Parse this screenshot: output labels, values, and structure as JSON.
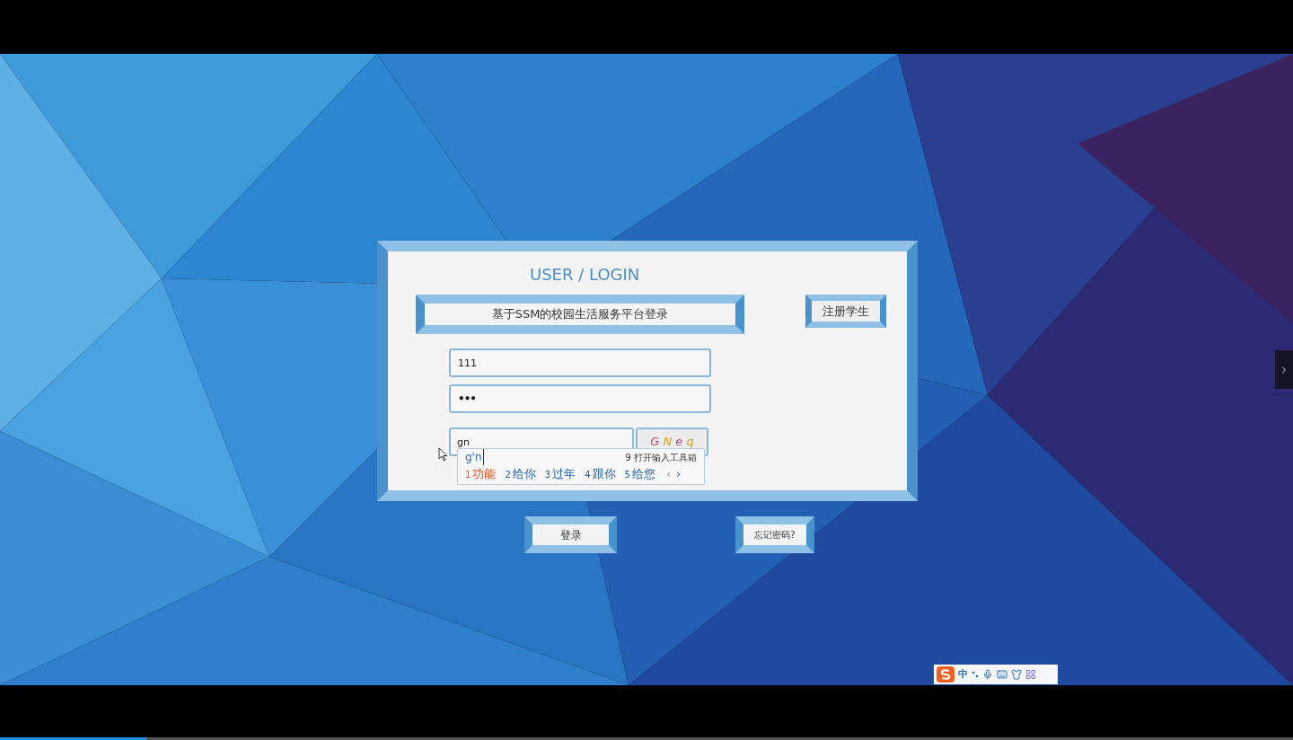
{
  "header_title": "USER / LOGIN",
  "banner": "基于SSM的校园生活服务平台登录",
  "register_button": "注册学生",
  "fields": [
    {
      "kind": "text",
      "value": "111"
    },
    {
      "kind": "password",
      "value": "•••"
    }
  ],
  "captcha_field": {
    "value": "gn"
  },
  "captcha_image": {
    "text": "G N e q"
  },
  "ime": {
    "composition": "g'n",
    "hint_number": "9",
    "hint": "打开输入工具箱",
    "candidates": [
      {
        "number": "1",
        "text": "功能",
        "selected": true
      },
      {
        "number": "2",
        "text": "给你",
        "selected": false
      },
      {
        "number": "3",
        "text": "过年",
        "selected": false
      },
      {
        "number": "4",
        "text": "跟你",
        "selected": false
      },
      {
        "number": "5",
        "text": "给您",
        "selected": false
      }
    ],
    "pager": [
      {
        "label": "‹",
        "disabled": true
      },
      {
        "label": "›",
        "disabled": false
      }
    ]
  },
  "login_button": "登录",
  "forgot_button": "忘记密码?",
  "ime_toolbar": {
    "mode": "中"
  },
  "video_progress": {
    "level": 0.113
  }
}
